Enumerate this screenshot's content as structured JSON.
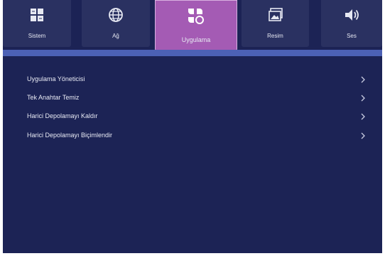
{
  "tabs": [
    {
      "label": "Sistem",
      "icon": "grid-icon"
    },
    {
      "label": "Ağ",
      "icon": "globe-icon"
    },
    {
      "label": "Uygulama",
      "icon": "apps-icon",
      "active": true
    },
    {
      "label": "Resim",
      "icon": "picture-icon"
    },
    {
      "label": "Ses",
      "icon": "speaker-icon"
    }
  ],
  "menu": {
    "items": [
      {
        "label": "Uygulama Yöneticisi"
      },
      {
        "label": "Tek Anahtar Temiz"
      },
      {
        "label": "Harici Depolamayı Kaldır"
      },
      {
        "label": "Harici Depolamayı Biçimlendir"
      }
    ]
  },
  "colors": {
    "background": "#1c2355",
    "tab": "#2a3161",
    "tab_active": "#a45bb4",
    "divider": "#4c61b5",
    "text": "#e8eaf4"
  }
}
